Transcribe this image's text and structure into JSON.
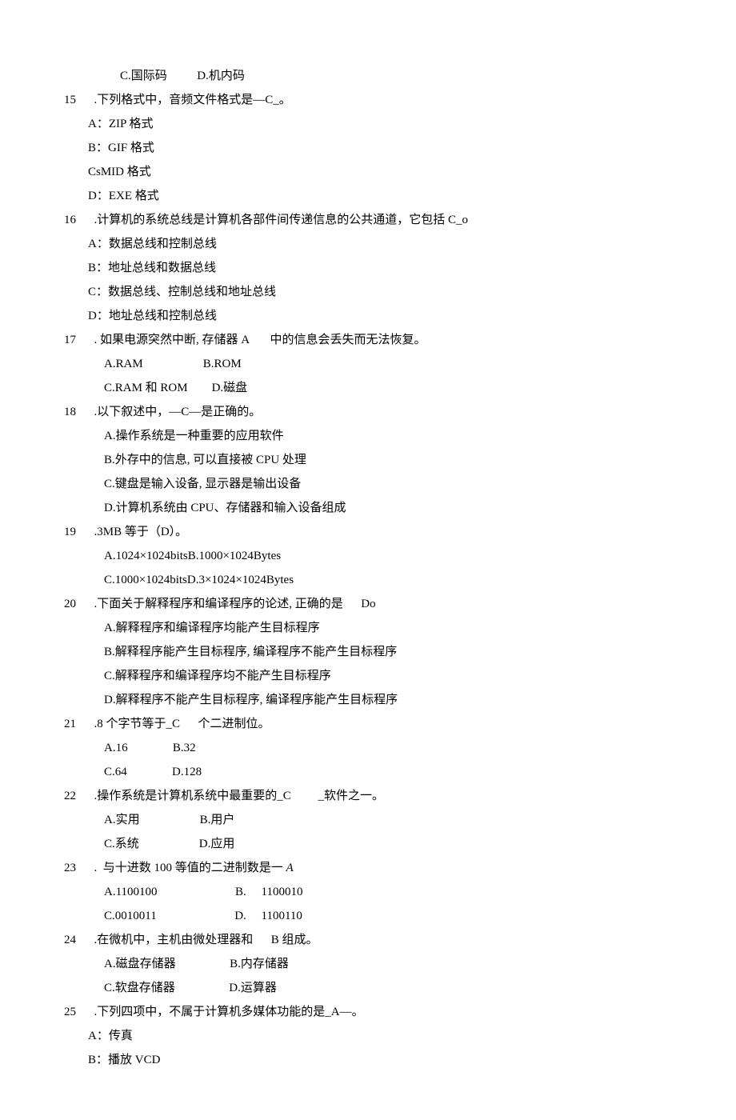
{
  "lines": [
    {
      "indent": "indent3",
      "text": "C.国际码          D.机内码"
    },
    {
      "num": "15",
      "text": "  .下列格式中，音频文件格式是—C_。"
    },
    {
      "indent": "indent1",
      "text": "A：ZIP 格式"
    },
    {
      "indent": "indent1",
      "text": "B：GIF 格式"
    },
    {
      "indent": "indent1",
      "text": "CsMID 格式"
    },
    {
      "indent": "indent1",
      "text": "D：EXE 格式"
    },
    {
      "num": "16",
      "text": "  .计算机的系统总线是计算机各部件间传递信息的公共通道，它包括 C_o"
    },
    {
      "indent": "indent1",
      "text": "A：数据总线和控制总线"
    },
    {
      "indent": "indent1",
      "text": "B：地址总线和数据总线"
    },
    {
      "indent": "indent1",
      "text": "C：数据总线、控制总线和地址总线"
    },
    {
      "indent": "indent1",
      "text": "D：地址总线和控制总线"
    },
    {
      "num": "17",
      "text": "  . 如果电源突然中断, 存储器 A       中的信息会丢失而无法恢复。"
    },
    {
      "indent": "indent2",
      "text": "A.RAM                    B.ROM"
    },
    {
      "indent": "indent2",
      "text": "C.RAM 和 ROM        D.磁盘"
    },
    {
      "num": "18",
      "text": "  .以下叙述中，—C—是正确的。"
    },
    {
      "indent": "indent2",
      "text": "A.操作系统是一种重要的应用软件"
    },
    {
      "indent": "indent2",
      "text": "B.外存中的信息, 可以直接被 CPU 处理"
    },
    {
      "indent": "indent2",
      "text": "C.键盘是输入设备, 显示器是输出设备"
    },
    {
      "indent": "indent2",
      "text": "D.计算机系统由 CPU、存储器和输入设备组成"
    },
    {
      "num": "19",
      "text": "  .3MB 等于（D）。"
    },
    {
      "indent": "indent2",
      "text": "A.1024×1024bitsB.1000×1024Bytes"
    },
    {
      "indent": "indent2",
      "text": "C.1000×1024bitsD.3×1024×1024Bytes"
    },
    {
      "num": "20",
      "text": "  .下面关于解释程序和编译程序的论述, 正确的是      Do"
    },
    {
      "indent": "indent2",
      "text": "A.解释程序和编译程序均能产生目标程序"
    },
    {
      "indent": "indent2",
      "text": "B.解释程序能产生目标程序, 编译程序不能产生目标程序"
    },
    {
      "indent": "indent2",
      "text": "C.解释程序和编译程序均不能产生目标程序"
    },
    {
      "indent": "indent2",
      "text": "D.解释程序不能产生目标程序, 编译程序能产生目标程序"
    },
    {
      "num": "21",
      "text": "  .8 个字节等于_C      个二进制位。"
    },
    {
      "indent": "indent2",
      "text": "A.16               B.32"
    },
    {
      "indent": "indent2",
      "text": "C.64               D.128"
    },
    {
      "num": "22",
      "text": "  .操作系统是计算机系统中最重要的_C         _软件之一。"
    },
    {
      "indent": "indent2",
      "text": "A.实用                    B.用户"
    },
    {
      "indent": "indent2",
      "text": "C.系统                    D.应用"
    },
    {
      "num": "23",
      "text": "  .  与十进数 100 等值的二进制数是一 A",
      "italic_tail": true
    },
    {
      "indent": "indent2",
      "text": "A.1100100                          B.     1100010"
    },
    {
      "indent": "indent2",
      "text": "C.0010011                          D.     1100110"
    },
    {
      "num": "24",
      "text": "  .在微机中，主机由微处理器和      B 组成。"
    },
    {
      "indent": "indent2",
      "text": "A.磁盘存储器                  B.内存储器"
    },
    {
      "indent": "indent2",
      "text": "C.软盘存储器                  D.运算器"
    },
    {
      "num": "25",
      "text": "  .下列四项中，不属于计算机多媒体功能的是_A—。"
    },
    {
      "indent": "indent1",
      "text": "A：传真"
    },
    {
      "indent": "indent1",
      "text": "B：播放 VCD"
    }
  ]
}
